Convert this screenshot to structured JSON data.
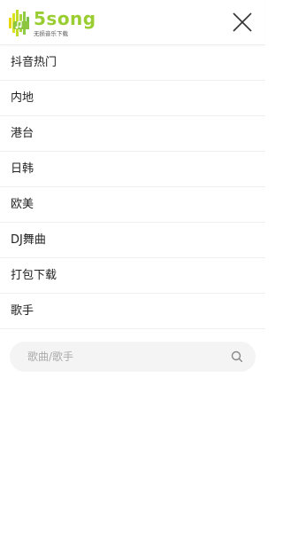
{
  "header": {
    "logo_text": "5song",
    "logo_subtitle": "无损音乐下载",
    "logo_icon": "music-waveform-logo-icon",
    "close_icon": "close-icon",
    "brand_color": "#9acd32"
  },
  "menu": {
    "items": [
      {
        "label": "抖音热门"
      },
      {
        "label": "内地"
      },
      {
        "label": "港台"
      },
      {
        "label": "日韩"
      },
      {
        "label": "欧美"
      },
      {
        "label": "DJ舞曲"
      },
      {
        "label": "打包下载"
      },
      {
        "label": "歌手"
      }
    ]
  },
  "search": {
    "placeholder": "歌曲/歌手",
    "value": "",
    "icon": "search-icon"
  }
}
